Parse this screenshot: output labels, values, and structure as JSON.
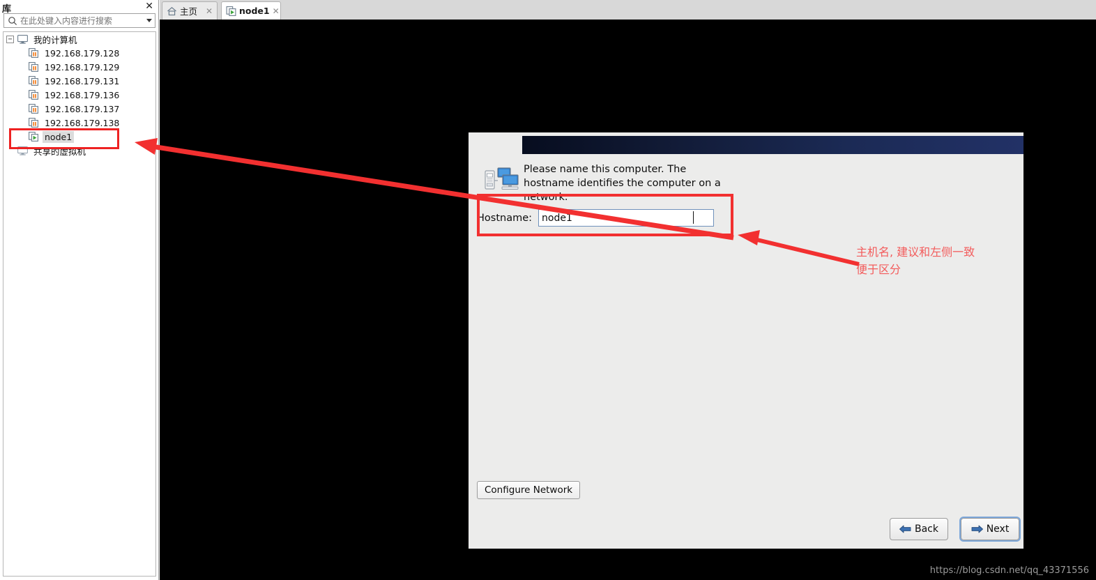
{
  "library": {
    "title": "库",
    "close_label": "✕",
    "search": {
      "placeholder": "在此处键入内容进行搜索",
      "value": "",
      "icon": "search-icon",
      "dropdown_icon": "chevron-down-icon"
    },
    "tree": {
      "root": {
        "label": "我的计算机",
        "icon": "monitor-icon",
        "expander": "−",
        "expanded": true
      },
      "items": [
        {
          "label": "192.168.179.128",
          "icon": "vm-suspended-icon",
          "state": "suspended"
        },
        {
          "label": "192.168.179.129",
          "icon": "vm-suspended-icon",
          "state": "suspended"
        },
        {
          "label": "192.168.179.131",
          "icon": "vm-suspended-icon",
          "state": "suspended"
        },
        {
          "label": "192.168.179.136",
          "icon": "vm-suspended-icon",
          "state": "suspended"
        },
        {
          "label": "192.168.179.137",
          "icon": "vm-suspended-icon",
          "state": "suspended"
        },
        {
          "label": "192.168.179.138",
          "icon": "vm-suspended-icon",
          "state": "suspended"
        },
        {
          "label": "node1",
          "icon": "vm-running-icon",
          "state": "running",
          "selected": true
        }
      ],
      "shared": {
        "label": "共享的虚拟机",
        "icon": "monitor-icon"
      }
    }
  },
  "tabs": [
    {
      "label": "主页",
      "icon": "home-icon",
      "close_label": "✕",
      "active": false
    },
    {
      "label": "node1",
      "icon": "vm-running-icon",
      "close_label": "✕",
      "active": true
    }
  ],
  "dialog": {
    "instruction": "Please name this computer.  The hostname identifies the computer on a network.",
    "hostname_label": "Hostname:",
    "hostname_value": "node1",
    "computer_icon": "computer-network-icon",
    "configure_network_label": "Configure Network",
    "back_label": "Back",
    "back_icon": "arrow-left-icon",
    "next_label": "Next",
    "next_icon": "arrow-right-icon"
  },
  "annotations": {
    "note_text": "主机名, 建议和左侧一致\n便于区分",
    "note_color": "#f35b5b",
    "box_color": "#f23030",
    "arrow_color": "#f23030"
  },
  "watermark": "https://blog.csdn.net/qq_43371556",
  "colors": {
    "accent_blue": "#223166",
    "dialog_bg": "#ececeb",
    "canvas_bg": "#000000"
  }
}
